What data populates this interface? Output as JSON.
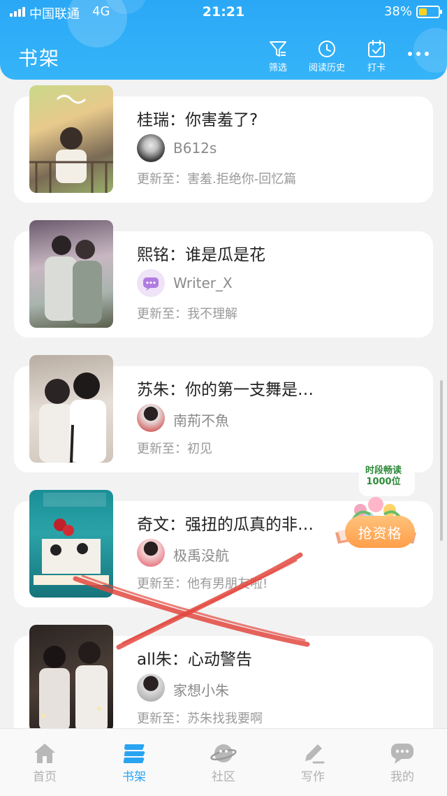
{
  "status_bar": {
    "carrier": "中国联通",
    "network": "4G",
    "time": "21:21",
    "battery": "38%"
  },
  "header": {
    "title": "书架",
    "actions": [
      {
        "label": "筛选",
        "icon": "filter-icon"
      },
      {
        "label": "阅读历史",
        "icon": "clock-icon"
      },
      {
        "label": "打卡",
        "icon": "calendar-check-icon"
      }
    ],
    "more_icon": "more-dots-icon"
  },
  "books": [
    {
      "title": "桂瑞：你害羞了?",
      "author": "B612s",
      "update": "更新至：害羞.拒绝你-回忆篇"
    },
    {
      "title": "熙铭：谁是瓜是花",
      "author": "Writer_X",
      "update": "更新至：我不理解"
    },
    {
      "title": "苏朱：你的第一支舞是…",
      "author": "南荊不魚",
      "update": "更新至：初见"
    },
    {
      "title": "奇文：强扭的瓜真的非…",
      "author": "极禹没航",
      "update": "更新至：他有男朋友啦!"
    },
    {
      "title": "all朱：心动警告",
      "author": "家想小朱",
      "update": "更新至：苏朱找我要啊"
    }
  ],
  "promo": {
    "label": "时段畅读 1000位",
    "button": "抢资格"
  },
  "tabbar": [
    {
      "label": "首页",
      "icon": "home-icon",
      "active": false
    },
    {
      "label": "书架",
      "icon": "bookshelf-icon",
      "active": true
    },
    {
      "label": "社区",
      "icon": "planet-icon",
      "active": false
    },
    {
      "label": "写作",
      "icon": "pen-icon",
      "active": false
    },
    {
      "label": "我的",
      "icon": "chat-bubble-icon",
      "active": false
    }
  ],
  "colors": {
    "brand": "#29a4f2",
    "promo_orange": "#ff9e4a"
  }
}
